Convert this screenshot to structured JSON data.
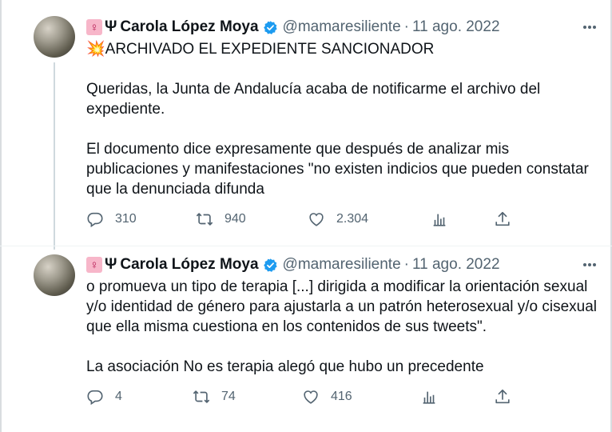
{
  "tweets": [
    {
      "display_name": "Carola López Moya",
      "name_prefix": "Ψ",
      "handle": "@mamaresiliente",
      "separator": "·",
      "date": "11 ago. 2022",
      "body": "💥ARCHIVADO EL EXPEDIENTE SANCIONADOR\n\nQueridas, la Junta de Andalucía acaba de notificarme el archivo del expediente.\n\nEl documento dice expresamente que después de analizar mis publicaciones y manifestaciones \"no existen indicios que pueden constatar que la denunciada difunda",
      "replies": "310",
      "retweets": "940",
      "likes": "2.304"
    },
    {
      "display_name": "Carola López Moya",
      "name_prefix": "Ψ",
      "handle": "@mamaresiliente",
      "separator": "·",
      "date": "11 ago. 2022",
      "body": "o promueva un tipo de terapia [...] dirigida a modificar la orientación sexual y/o identidad de género para ajustarla a un patrón heterosexual y/o cisexual que ella misma cuestiona en los contenidos de sus tweets\".\n\nLa asociación No es terapia alegó que hubo un precedente",
      "replies": "4",
      "retweets": "74",
      "likes": "416"
    }
  ],
  "icons": {
    "badge": "venus-emoji-icon",
    "verified": "verified-badge-icon",
    "more": "more-options-icon",
    "reply": "reply-icon",
    "retweet": "retweet-icon",
    "like": "like-icon",
    "views": "views-icon",
    "share": "share-icon"
  },
  "colors": {
    "verified": "#1d9bf0",
    "secondary_text": "#536471",
    "badge_bg": "#f7b6c9"
  }
}
